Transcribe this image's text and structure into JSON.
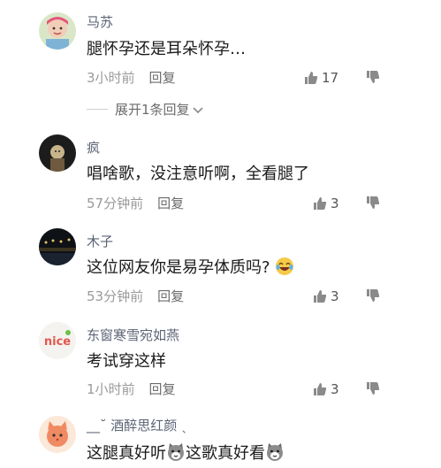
{
  "comments": [
    {
      "username": "马苏",
      "text": "腿怀孕还是耳朵怀孕…",
      "time": "3小时前",
      "reply": "回复",
      "likes": "17",
      "avatar_icon": "girl-photo-avatar"
    },
    {
      "username": "疯",
      "text": "唱啥歌，没注意听啊，全看腿了",
      "time": "57分钟前",
      "reply": "回复",
      "likes": "3",
      "avatar_icon": "dark-photo-avatar"
    },
    {
      "username": "木子",
      "text": "这位网友你是易孕体质吗?",
      "time": "53分钟前",
      "reply": "回复",
      "likes": "3",
      "avatar_icon": "night-scene-avatar",
      "emoji": "laughing-crying-emoji"
    },
    {
      "username": "东窗寒雪宛如燕",
      "text": "考试穿这样",
      "time": "1小时前",
      "reply": "回复",
      "likes": "3",
      "avatar_icon": "nice-logo-avatar",
      "avatar_text": "nice"
    },
    {
      "username_prefix": "__˘",
      "username": "酒醉思红颜",
      "username_suffix": "ˎ",
      "text_part1": "这腿真好听",
      "text_part2": "这歌真好看",
      "avatar_icon": "cartoon-cat-avatar",
      "emoji": "cat-face-emoji"
    }
  ],
  "expand_replies": "展开1条回复",
  "icons": {
    "like": "thumbs-up-icon",
    "dislike": "thumbs-down-icon",
    "expand": "chevron-down-icon"
  },
  "colors": {
    "username": "#5b6475",
    "meta": "#9a9a9a",
    "text": "#1a1a1a"
  }
}
